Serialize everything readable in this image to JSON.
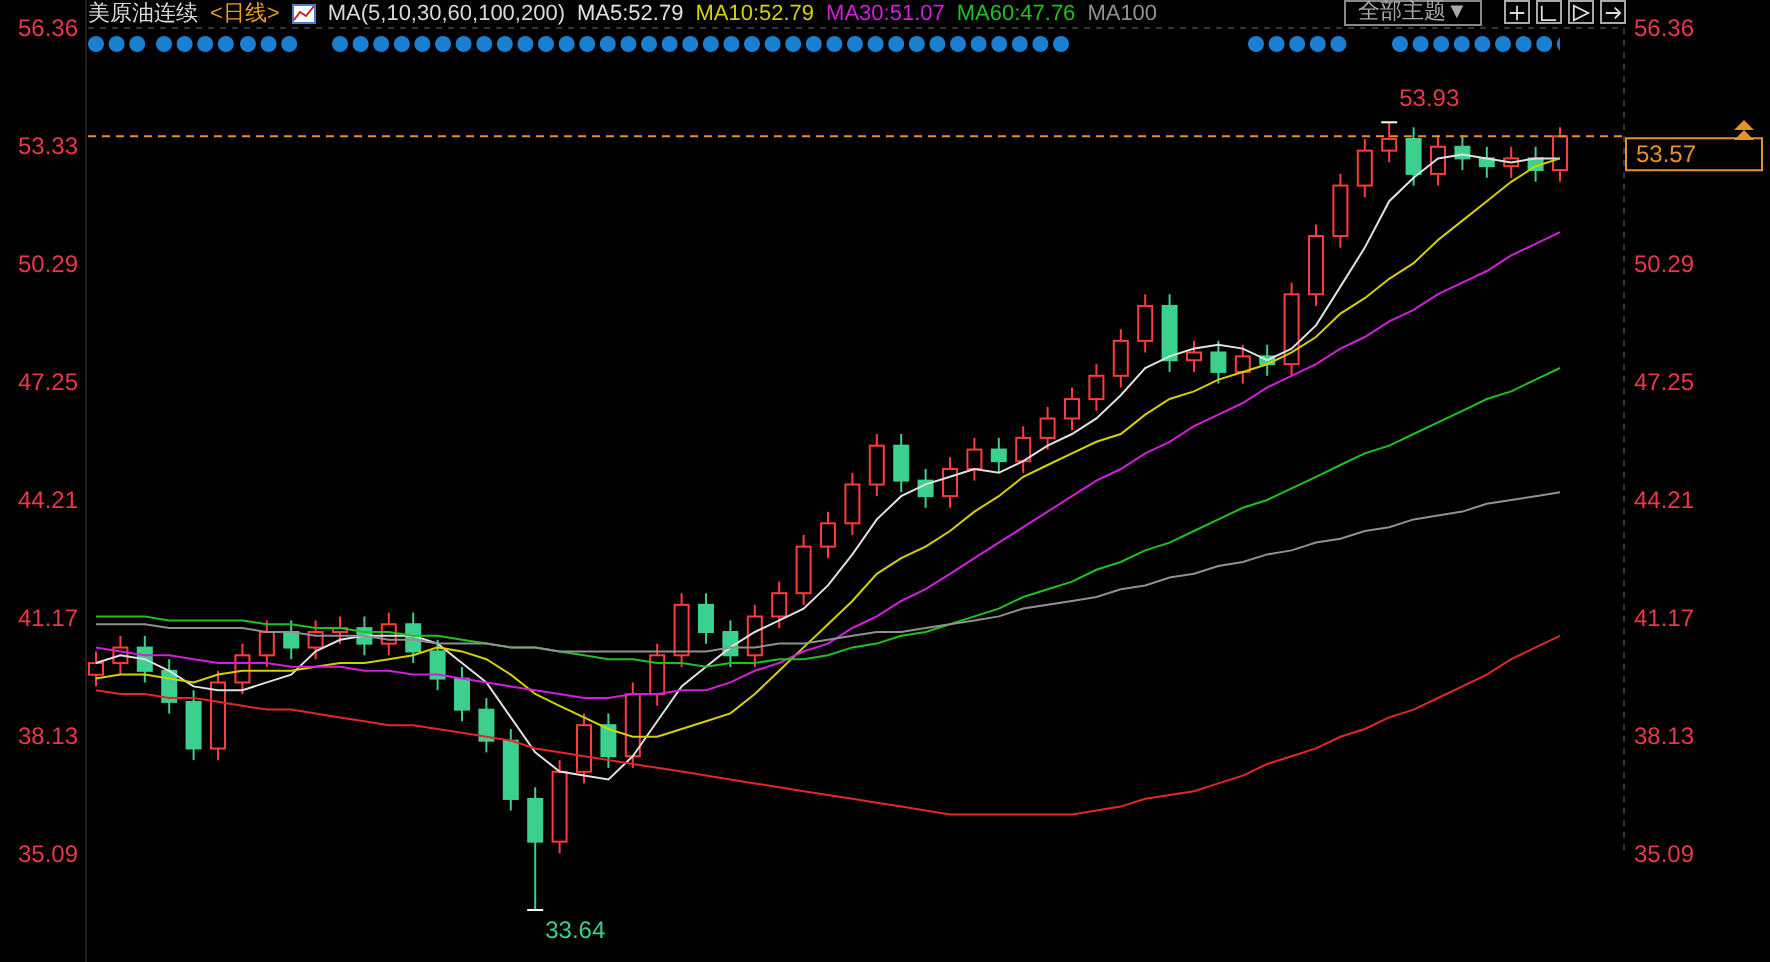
{
  "header": {
    "title": "美原油连续",
    "period": "<日线>",
    "indicator": "MA(5,10,30,60,100,200)",
    "theme_dropdown": "全部主题▼"
  },
  "chart": {
    "chart_data": {
      "type": "candlestick",
      "ylim": [
        32.3,
        57.08
      ],
      "yticks": [
        {
          "value": 56.36,
          "label": "56.36"
        },
        {
          "value": 53.33,
          "label": "53.33"
        },
        {
          "value": 50.29,
          "label": "50.29"
        },
        {
          "value": 47.25,
          "label": "47.25"
        },
        {
          "value": 44.21,
          "label": "44.21"
        },
        {
          "value": 41.17,
          "label": "41.17"
        },
        {
          "value": 38.13,
          "label": "38.13"
        },
        {
          "value": 35.09,
          "label": "35.09"
        }
      ],
      "ohlc": [
        [
          39.7,
          40.3,
          39.4,
          40.0
        ],
        [
          40.0,
          40.7,
          39.7,
          40.4
        ],
        [
          40.4,
          40.7,
          39.5,
          39.8
        ],
        [
          39.8,
          40.1,
          38.7,
          39.0
        ],
        [
          39.0,
          39.3,
          37.5,
          37.8
        ],
        [
          37.8,
          39.8,
          37.5,
          39.5
        ],
        [
          39.5,
          40.5,
          39.2,
          40.2
        ],
        [
          40.2,
          41.1,
          39.9,
          40.8
        ],
        [
          40.8,
          41.1,
          40.1,
          40.4
        ],
        [
          40.4,
          41.1,
          40.1,
          40.8
        ],
        [
          40.8,
          41.2,
          40.5,
          40.9
        ],
        [
          40.9,
          41.2,
          40.2,
          40.5
        ],
        [
          40.5,
          41.3,
          40.2,
          41.0
        ],
        [
          41.0,
          41.3,
          40.0,
          40.3
        ],
        [
          40.3,
          40.6,
          39.3,
          39.6
        ],
        [
          39.6,
          39.9,
          38.5,
          38.8
        ],
        [
          38.8,
          39.1,
          37.7,
          38.0
        ],
        [
          38.0,
          38.3,
          36.2,
          36.5
        ],
        [
          36.5,
          36.8,
          33.64,
          35.4
        ],
        [
          35.4,
          37.5,
          35.1,
          37.2
        ],
        [
          37.2,
          38.7,
          36.9,
          38.4
        ],
        [
          38.4,
          38.7,
          37.3,
          37.6
        ],
        [
          37.6,
          39.5,
          37.3,
          39.2
        ],
        [
          39.2,
          40.5,
          38.9,
          40.2
        ],
        [
          40.2,
          41.8,
          39.9,
          41.5
        ],
        [
          41.5,
          41.8,
          40.5,
          40.8
        ],
        [
          40.8,
          41.1,
          39.9,
          40.2
        ],
        [
          40.2,
          41.5,
          39.9,
          41.2
        ],
        [
          41.2,
          42.1,
          40.9,
          41.8
        ],
        [
          41.8,
          43.3,
          41.5,
          43.0
        ],
        [
          43.0,
          43.9,
          42.7,
          43.6
        ],
        [
          43.6,
          44.9,
          43.3,
          44.6
        ],
        [
          44.6,
          45.9,
          44.3,
          45.6
        ],
        [
          45.6,
          45.9,
          44.4,
          44.7
        ],
        [
          44.7,
          45.0,
          44.0,
          44.3
        ],
        [
          44.3,
          45.3,
          44.0,
          45.0
        ],
        [
          45.0,
          45.8,
          44.7,
          45.5
        ],
        [
          45.5,
          45.8,
          44.9,
          45.2
        ],
        [
          45.2,
          46.1,
          44.9,
          45.8
        ],
        [
          45.8,
          46.6,
          45.5,
          46.3
        ],
        [
          46.3,
          47.1,
          46.0,
          46.8
        ],
        [
          46.8,
          47.7,
          46.5,
          47.4
        ],
        [
          47.4,
          48.6,
          47.1,
          48.3
        ],
        [
          48.3,
          49.5,
          48.0,
          49.2
        ],
        [
          49.2,
          49.5,
          47.5,
          47.8
        ],
        [
          47.8,
          48.3,
          47.5,
          48.0
        ],
        [
          48.0,
          48.3,
          47.2,
          47.5
        ],
        [
          47.5,
          48.2,
          47.2,
          47.9
        ],
        [
          47.9,
          48.2,
          47.4,
          47.7
        ],
        [
          47.7,
          49.8,
          47.4,
          49.5
        ],
        [
          49.5,
          51.3,
          49.2,
          51.0
        ],
        [
          51.0,
          52.6,
          50.7,
          52.3
        ],
        [
          52.3,
          53.5,
          52.0,
          53.2
        ],
        [
          53.2,
          53.93,
          52.9,
          53.5
        ],
        [
          53.5,
          53.8,
          52.3,
          52.6
        ],
        [
          52.6,
          53.6,
          52.3,
          53.3
        ],
        [
          53.3,
          53.6,
          52.7,
          53.0
        ],
        [
          53.0,
          53.3,
          52.5,
          52.8
        ],
        [
          52.8,
          53.3,
          52.5,
          53.0
        ],
        [
          53.0,
          53.3,
          52.4,
          52.7
        ],
        [
          52.7,
          53.8,
          52.4,
          53.57
        ]
      ],
      "annotations": [
        "53.93",
        "33.64"
      ]
    }
  },
  "ma_chart": {
    "chart_data": {
      "type": "line",
      "ylim": [
        35.09,
        56.36
      ],
      "yticks": [
        {
          "value": 56.36,
          "label": "56.36"
        },
        {
          "value": 50.29,
          "label": "50.29"
        },
        {
          "value": 47.25,
          "label": "47.25"
        },
        {
          "value": 44.21,
          "label": "44.21"
        },
        {
          "value": 41.17,
          "label": "41.17"
        },
        {
          "value": 38.13,
          "label": "38.13"
        },
        {
          "value": 35.09,
          "label": "35.09"
        }
      ],
      "series": [
        {
          "name": "MA5:52.79",
          "color": "#e0e0e0",
          "values": [
            40.0,
            40.2,
            40.1,
            39.8,
            39.4,
            39.3,
            39.3,
            39.5,
            39.7,
            40.3,
            40.6,
            40.7,
            40.7,
            40.7,
            40.5,
            40.0,
            39.5,
            38.6,
            37.7,
            37.2,
            37.1,
            37.0,
            37.6,
            38.5,
            39.4,
            39.9,
            40.4,
            40.8,
            41.1,
            41.4,
            42.0,
            42.8,
            43.7,
            44.3,
            44.6,
            44.8,
            45.0,
            44.9,
            45.2,
            45.6,
            45.9,
            46.3,
            46.9,
            47.6,
            47.9,
            48.1,
            48.2,
            48.1,
            47.8,
            48.1,
            48.7,
            49.7,
            50.7,
            51.9,
            52.5,
            53.0,
            53.1,
            53.0,
            52.9,
            53.0,
            53.0
          ]
        },
        {
          "name": "MA10:52.79",
          "color": "#d4d000",
          "values": [
            39.6,
            39.7,
            39.7,
            39.6,
            39.5,
            39.7,
            39.8,
            39.8,
            39.8,
            39.9,
            40.0,
            40.0,
            40.1,
            40.2,
            40.4,
            40.3,
            40.1,
            39.7,
            39.2,
            38.9,
            38.6,
            38.3,
            38.1,
            38.1,
            38.3,
            38.5,
            38.7,
            39.2,
            39.8,
            40.4,
            41.0,
            41.6,
            42.3,
            42.7,
            43.0,
            43.4,
            43.9,
            44.3,
            44.8,
            45.1,
            45.4,
            45.7,
            45.9,
            46.4,
            46.8,
            47.0,
            47.3,
            47.5,
            47.7,
            48.0,
            48.4,
            49.0,
            49.4,
            49.9,
            50.3,
            50.9,
            51.4,
            51.9,
            52.4,
            52.8,
            53.0
          ]
        },
        {
          "name": "MA30:51.07",
          "color": "#d020d8",
          "values": [
            40.4,
            40.3,
            40.2,
            40.2,
            40.1,
            40.0,
            40.0,
            40.0,
            39.9,
            39.9,
            39.9,
            39.8,
            39.8,
            39.7,
            39.7,
            39.6,
            39.5,
            39.4,
            39.3,
            39.2,
            39.1,
            39.1,
            39.2,
            39.2,
            39.3,
            39.3,
            39.5,
            39.8,
            40.0,
            40.3,
            40.5,
            40.9,
            41.2,
            41.6,
            41.9,
            42.3,
            42.7,
            43.1,
            43.5,
            43.9,
            44.3,
            44.7,
            45.0,
            45.4,
            45.7,
            46.1,
            46.4,
            46.7,
            47.1,
            47.4,
            47.7,
            48.1,
            48.4,
            48.8,
            49.1,
            49.5,
            49.8,
            50.1,
            50.5,
            50.8,
            51.1
          ]
        },
        {
          "name": "MA60:47.76",
          "color": "#20c020",
          "values": [
            41.2,
            41.2,
            41.2,
            41.1,
            41.1,
            41.1,
            41.1,
            41.0,
            41.0,
            40.9,
            40.9,
            40.8,
            40.8,
            40.7,
            40.7,
            40.6,
            40.5,
            40.4,
            40.4,
            40.3,
            40.2,
            40.1,
            40.1,
            40.0,
            40.0,
            39.9,
            40.0,
            40.0,
            40.1,
            40.1,
            40.2,
            40.4,
            40.5,
            40.7,
            40.8,
            41.0,
            41.2,
            41.4,
            41.7,
            41.9,
            42.1,
            42.4,
            42.6,
            42.9,
            43.1,
            43.4,
            43.7,
            44.0,
            44.2,
            44.5,
            44.8,
            45.1,
            45.4,
            45.6,
            45.9,
            46.2,
            46.5,
            46.8,
            47.0,
            47.3,
            47.6
          ]
        },
        {
          "name": "MA100",
          "color": "#909090",
          "values": [
            41.0,
            41.0,
            41.0,
            40.9,
            40.9,
            40.9,
            40.9,
            40.8,
            40.8,
            40.7,
            40.7,
            40.7,
            40.6,
            40.6,
            40.5,
            40.5,
            40.5,
            40.4,
            40.4,
            40.3,
            40.3,
            40.3,
            40.3,
            40.3,
            40.3,
            40.3,
            40.4,
            40.4,
            40.5,
            40.5,
            40.6,
            40.7,
            40.8,
            40.8,
            40.9,
            41.0,
            41.1,
            41.2,
            41.4,
            41.5,
            41.6,
            41.7,
            41.9,
            42.0,
            42.2,
            42.3,
            42.5,
            42.6,
            42.8,
            42.9,
            43.1,
            43.2,
            43.4,
            43.5,
            43.7,
            43.8,
            43.9,
            44.1,
            44.2,
            44.3,
            44.4
          ]
        },
        {
          "color": "#e02828",
          "values": [
            39.3,
            39.2,
            39.2,
            39.1,
            39.1,
            39.0,
            38.9,
            38.8,
            38.8,
            38.7,
            38.6,
            38.5,
            38.4,
            38.4,
            38.3,
            38.2,
            38.1,
            38.0,
            37.8,
            37.7,
            37.6,
            37.5,
            37.4,
            37.3,
            37.2,
            37.1,
            37.0,
            36.9,
            36.8,
            36.7,
            36.6,
            36.5,
            36.4,
            36.3,
            36.2,
            36.1,
            36.1,
            36.1,
            36.1,
            36.1,
            36.1,
            36.2,
            36.3,
            36.5,
            36.6,
            36.7,
            36.9,
            37.1,
            37.4,
            37.6,
            37.8,
            38.1,
            38.3,
            38.6,
            38.8,
            39.1,
            39.4,
            39.7,
            40.1,
            40.4,
            40.7
          ]
        }
      ]
    }
  },
  "current_price": "53.57"
}
